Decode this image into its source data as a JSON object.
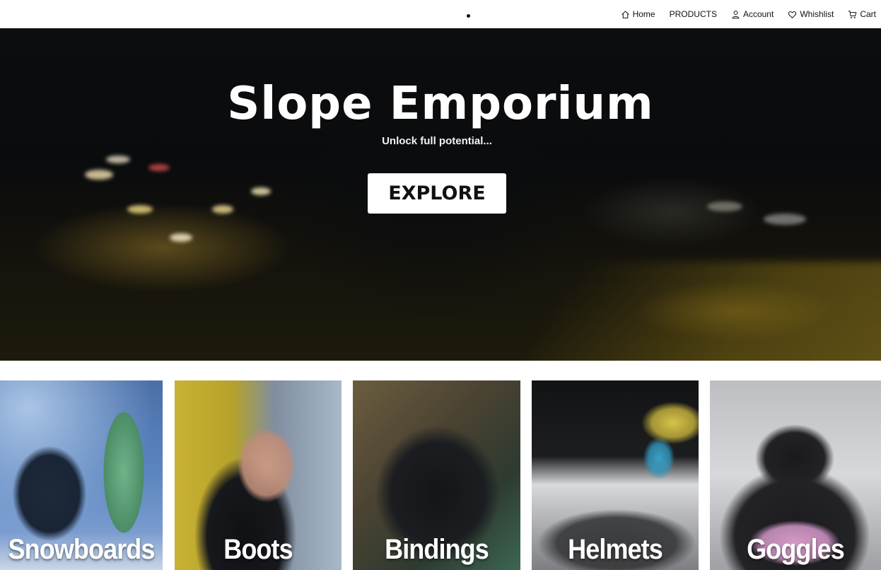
{
  "nav": {
    "items": [
      {
        "label": "Home",
        "icon": "home-icon"
      },
      {
        "label": "PRODUCTS",
        "icon": ""
      },
      {
        "label": "Account",
        "icon": "user-icon"
      },
      {
        "label": "Whishlist",
        "icon": "heart-icon"
      },
      {
        "label": "Cart",
        "icon": "cart-icon"
      }
    ]
  },
  "hero": {
    "title": "Slope Emporium",
    "subtitle": "Unlock full potential...",
    "cta_label": "EXPLORE"
  },
  "categories": [
    {
      "label": "Snowboards"
    },
    {
      "label": "Boots"
    },
    {
      "label": "Bindings"
    },
    {
      "label": "Helmets"
    },
    {
      "label": "Goggles"
    }
  ]
}
